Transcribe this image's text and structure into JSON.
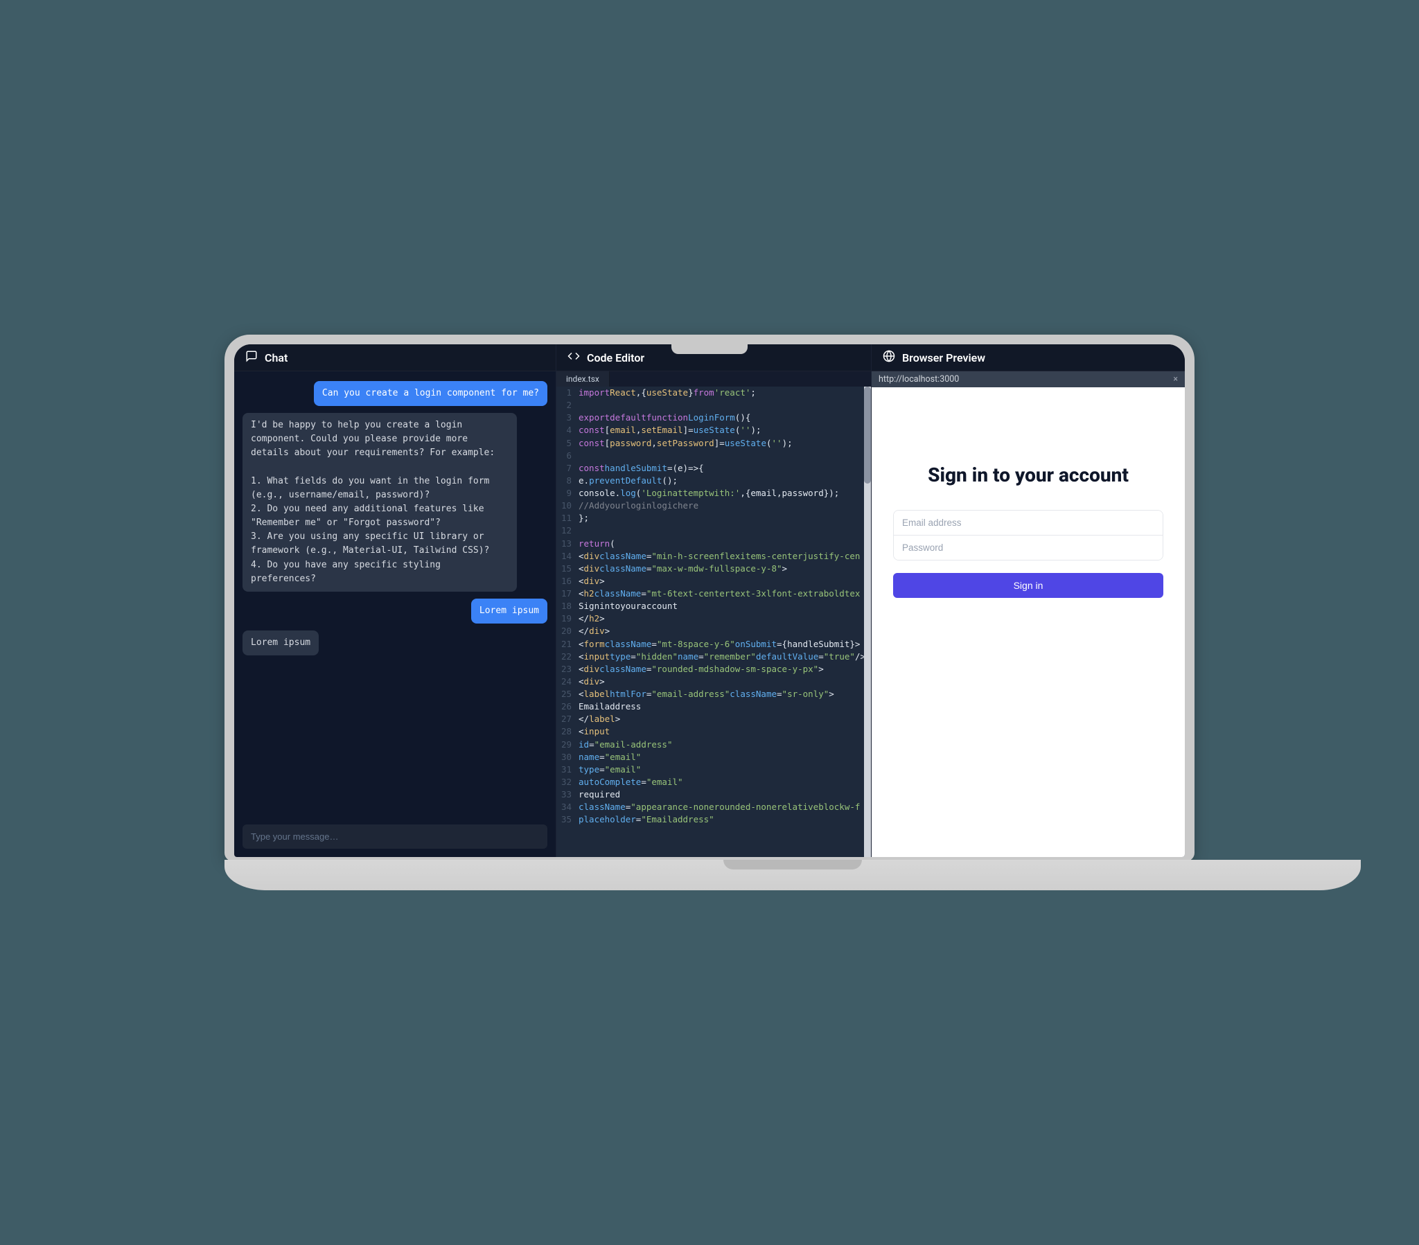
{
  "chat": {
    "title": "Chat",
    "messages": [
      {
        "role": "user",
        "text": "Can you create a login component for me?"
      },
      {
        "role": "assistant",
        "text": "I'd be happy to help you create a login component. Could you please provide more details about your requirements? For example:\n\n1. What fields do you want in the login form (e.g., username/email, password)?\n2. Do you need any additional features like \"Remember me\" or \"Forgot password\"?\n3. Are you using any specific UI library or framework (e.g., Material-UI, Tailwind CSS)?\n4. Do you have any specific styling preferences?"
      },
      {
        "role": "user",
        "text": "Lorem ipsum"
      },
      {
        "role": "assistant",
        "text": "Lorem ipsum"
      }
    ],
    "input_placeholder": "Type your message…"
  },
  "editor": {
    "title": "Code Editor",
    "tab": "index.tsx",
    "lines": [
      [
        [
          "kw",
          "import"
        ],
        [
          "id",
          "React"
        ],
        [
          "",
          ","
        ],
        [
          "",
          "{"
        ],
        [
          "id",
          "useState"
        ],
        [
          "",
          "}"
        ],
        [
          "kw",
          "from"
        ],
        [
          "str",
          "'react'"
        ],
        [
          "",
          ";"
        ]
      ],
      [],
      [
        [
          "kw",
          "export"
        ],
        [
          "kw",
          "default"
        ],
        [
          "kw",
          "function"
        ],
        [
          "fn",
          "LoginForm"
        ],
        [
          "",
          "(){"
        ]
      ],
      [
        [
          "kw",
          "const"
        ],
        [
          "",
          "["
        ],
        [
          "id",
          "email"
        ],
        [
          "",
          ","
        ],
        [
          "id",
          "setEmail"
        ],
        [
          "",
          "]="
        ],
        [
          "fn",
          "useState"
        ],
        [
          "",
          "("
        ],
        [
          "str",
          "''"
        ],
        [
          "",
          ");"
        ]
      ],
      [
        [
          "kw",
          "const"
        ],
        [
          "",
          "["
        ],
        [
          "id",
          "password"
        ],
        [
          "",
          ","
        ],
        [
          "id",
          "setPassword"
        ],
        [
          "",
          "]="
        ],
        [
          "fn",
          "useState"
        ],
        [
          "",
          "("
        ],
        [
          "str",
          "''"
        ],
        [
          "",
          ");"
        ]
      ],
      [],
      [
        [
          "kw",
          "const"
        ],
        [
          "fn",
          "handleSubmit"
        ],
        [
          "",
          "=(e)=>{"
        ]
      ],
      [
        [
          "",
          "e."
        ],
        [
          "fn",
          "preventDefault"
        ],
        [
          "",
          "();"
        ]
      ],
      [
        [
          "",
          "console."
        ],
        [
          "fn",
          "log"
        ],
        [
          "",
          "("
        ],
        [
          "str",
          "'Loginattemptwith:'"
        ],
        [
          "",
          ",{email,password});"
        ]
      ],
      [
        [
          "com",
          "//Addyourloginlogichere"
        ]
      ],
      [
        [
          "",
          "};"
        ]
      ],
      [],
      [
        [
          "kw",
          "return"
        ],
        [
          "",
          "("
        ]
      ],
      [
        [
          "",
          "<"
        ],
        [
          "id",
          "div"
        ],
        [
          "fn",
          "className"
        ],
        [
          "",
          "="
        ],
        [
          "str",
          "\"min-h-screenflexitems-centerjustify-cen"
        ]
      ],
      [
        [
          "",
          "<"
        ],
        [
          "id",
          "div"
        ],
        [
          "fn",
          "className"
        ],
        [
          "",
          "="
        ],
        [
          "str",
          "\"max-w-mdw-fullspace-y-8\""
        ],
        [
          "",
          ">"
        ]
      ],
      [
        [
          "",
          "<"
        ],
        [
          "id",
          "div"
        ],
        [
          "",
          ">"
        ]
      ],
      [
        [
          "",
          "<"
        ],
        [
          "id",
          "h2"
        ],
        [
          "fn",
          "className"
        ],
        [
          "",
          "="
        ],
        [
          "str",
          "\"mt-6text-centertext-3xlfont-extraboldtex"
        ]
      ],
      [
        [
          "",
          "Signintoyouraccount"
        ]
      ],
      [
        [
          "",
          "</"
        ],
        [
          "id",
          "h2"
        ],
        [
          "",
          ">"
        ]
      ],
      [
        [
          "",
          "</"
        ],
        [
          "id",
          "div"
        ],
        [
          "",
          ">"
        ]
      ],
      [
        [
          "",
          "<"
        ],
        [
          "id",
          "form"
        ],
        [
          "fn",
          "className"
        ],
        [
          "",
          "="
        ],
        [
          "str",
          "\"mt-8space-y-6\""
        ],
        [
          "fn",
          "onSubmit"
        ],
        [
          "",
          "={handleSubmit}>"
        ]
      ],
      [
        [
          "",
          "<"
        ],
        [
          "id",
          "input"
        ],
        [
          "fn",
          "type"
        ],
        [
          "",
          "="
        ],
        [
          "str",
          "\"hidden\""
        ],
        [
          "fn",
          "name"
        ],
        [
          "",
          "="
        ],
        [
          "str",
          "\"remember\""
        ],
        [
          "fn",
          "defaultValue"
        ],
        [
          "",
          "="
        ],
        [
          "str",
          "\"true\""
        ],
        [
          "",
          "/>"
        ]
      ],
      [
        [
          "",
          "<"
        ],
        [
          "id",
          "div"
        ],
        [
          "fn",
          "className"
        ],
        [
          "",
          "="
        ],
        [
          "str",
          "\"rounded-mdshadow-sm-space-y-px\""
        ],
        [
          "",
          ">"
        ]
      ],
      [
        [
          "",
          "<"
        ],
        [
          "id",
          "div"
        ],
        [
          "",
          ">"
        ]
      ],
      [
        [
          "",
          "<"
        ],
        [
          "id",
          "label"
        ],
        [
          "fn",
          "htmlFor"
        ],
        [
          "",
          "="
        ],
        [
          "str",
          "\"email-address\""
        ],
        [
          "fn",
          "className"
        ],
        [
          "",
          "="
        ],
        [
          "str",
          "\"sr-only\""
        ],
        [
          "",
          ">"
        ]
      ],
      [
        [
          "",
          "Emailaddress"
        ]
      ],
      [
        [
          "",
          "</"
        ],
        [
          "id",
          "label"
        ],
        [
          "",
          ">"
        ]
      ],
      [
        [
          "",
          "<"
        ],
        [
          "id",
          "input"
        ]
      ],
      [
        [
          "fn",
          "id"
        ],
        [
          "",
          "="
        ],
        [
          "str",
          "\"email-address\""
        ]
      ],
      [
        [
          "fn",
          "name"
        ],
        [
          "",
          "="
        ],
        [
          "str",
          "\"email\""
        ]
      ],
      [
        [
          "fn",
          "type"
        ],
        [
          "",
          "="
        ],
        [
          "str",
          "\"email\""
        ]
      ],
      [
        [
          "fn",
          "autoComplete"
        ],
        [
          "",
          "="
        ],
        [
          "str",
          "\"email\""
        ]
      ],
      [
        [
          "",
          "required"
        ]
      ],
      [
        [
          "fn",
          "className"
        ],
        [
          "",
          "="
        ],
        [
          "str",
          "\"appearance-nonerounded-nonerelativeblockw-f"
        ]
      ],
      [
        [
          "fn",
          "placeholder"
        ],
        [
          "",
          "="
        ],
        [
          "str",
          "\"Emailaddress\""
        ]
      ]
    ]
  },
  "preview": {
    "title": "Browser Preview",
    "url": "http://localhost:3000",
    "close_glyph": "×",
    "page": {
      "heading": "Sign in to your account",
      "email_placeholder": "Email address",
      "password_placeholder": "Password",
      "button_label": "Sign in"
    }
  }
}
